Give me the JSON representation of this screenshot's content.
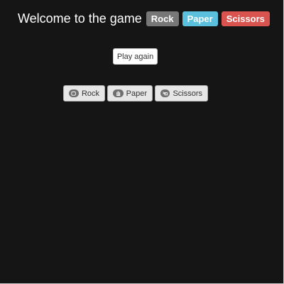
{
  "header": {
    "title": "Welcome to the game",
    "badges": {
      "rock": "Rock",
      "paper": "Paper",
      "scissors": "Scissors"
    }
  },
  "controls": {
    "play_again_label": "Play again"
  },
  "choices": {
    "rock": {
      "label": "Rock",
      "icon": "hand-rock-icon"
    },
    "paper": {
      "label": "Paper",
      "icon": "hand-paper-icon"
    },
    "scissors": {
      "label": "Scissors",
      "icon": "hand-scissors-icon"
    }
  },
  "colors": {
    "background": "#151515",
    "rock_badge": "#777777",
    "paper_badge": "#5bc0de",
    "scissors_badge": "#d9534f"
  }
}
